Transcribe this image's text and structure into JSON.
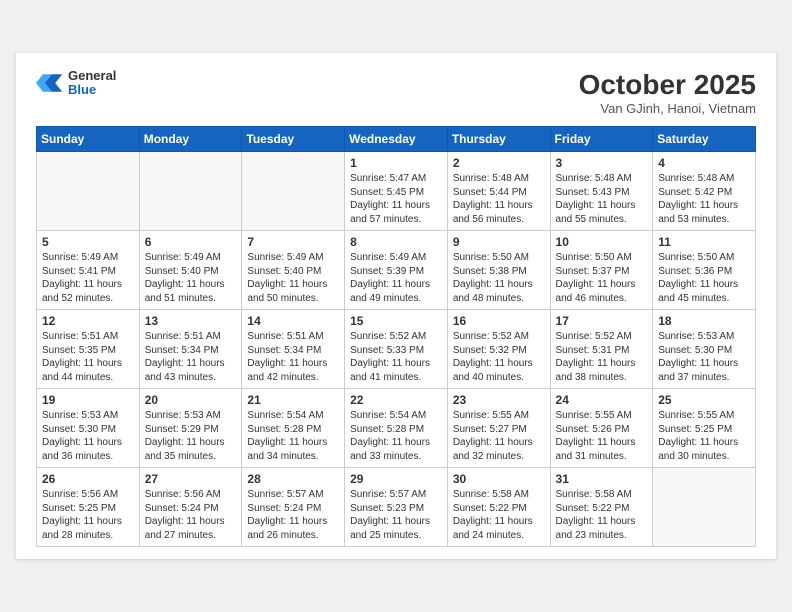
{
  "header": {
    "logo": {
      "general": "General",
      "blue": "Blue"
    },
    "title": "October 2025",
    "location": "Van GJinh, Hanoi, Vietnam"
  },
  "weekdays": [
    "Sunday",
    "Monday",
    "Tuesday",
    "Wednesday",
    "Thursday",
    "Friday",
    "Saturday"
  ],
  "weeks": [
    [
      {
        "day": "",
        "info": ""
      },
      {
        "day": "",
        "info": ""
      },
      {
        "day": "",
        "info": ""
      },
      {
        "day": "1",
        "info": "Sunrise: 5:47 AM\nSunset: 5:45 PM\nDaylight: 11 hours\nand 57 minutes."
      },
      {
        "day": "2",
        "info": "Sunrise: 5:48 AM\nSunset: 5:44 PM\nDaylight: 11 hours\nand 56 minutes."
      },
      {
        "day": "3",
        "info": "Sunrise: 5:48 AM\nSunset: 5:43 PM\nDaylight: 11 hours\nand 55 minutes."
      },
      {
        "day": "4",
        "info": "Sunrise: 5:48 AM\nSunset: 5:42 PM\nDaylight: 11 hours\nand 53 minutes."
      }
    ],
    [
      {
        "day": "5",
        "info": "Sunrise: 5:49 AM\nSunset: 5:41 PM\nDaylight: 11 hours\nand 52 minutes."
      },
      {
        "day": "6",
        "info": "Sunrise: 5:49 AM\nSunset: 5:40 PM\nDaylight: 11 hours\nand 51 minutes."
      },
      {
        "day": "7",
        "info": "Sunrise: 5:49 AM\nSunset: 5:40 PM\nDaylight: 11 hours\nand 50 minutes."
      },
      {
        "day": "8",
        "info": "Sunrise: 5:49 AM\nSunset: 5:39 PM\nDaylight: 11 hours\nand 49 minutes."
      },
      {
        "day": "9",
        "info": "Sunrise: 5:50 AM\nSunset: 5:38 PM\nDaylight: 11 hours\nand 48 minutes."
      },
      {
        "day": "10",
        "info": "Sunrise: 5:50 AM\nSunset: 5:37 PM\nDaylight: 11 hours\nand 46 minutes."
      },
      {
        "day": "11",
        "info": "Sunrise: 5:50 AM\nSunset: 5:36 PM\nDaylight: 11 hours\nand 45 minutes."
      }
    ],
    [
      {
        "day": "12",
        "info": "Sunrise: 5:51 AM\nSunset: 5:35 PM\nDaylight: 11 hours\nand 44 minutes."
      },
      {
        "day": "13",
        "info": "Sunrise: 5:51 AM\nSunset: 5:34 PM\nDaylight: 11 hours\nand 43 minutes."
      },
      {
        "day": "14",
        "info": "Sunrise: 5:51 AM\nSunset: 5:34 PM\nDaylight: 11 hours\nand 42 minutes."
      },
      {
        "day": "15",
        "info": "Sunrise: 5:52 AM\nSunset: 5:33 PM\nDaylight: 11 hours\nand 41 minutes."
      },
      {
        "day": "16",
        "info": "Sunrise: 5:52 AM\nSunset: 5:32 PM\nDaylight: 11 hours\nand 40 minutes."
      },
      {
        "day": "17",
        "info": "Sunrise: 5:52 AM\nSunset: 5:31 PM\nDaylight: 11 hours\nand 38 minutes."
      },
      {
        "day": "18",
        "info": "Sunrise: 5:53 AM\nSunset: 5:30 PM\nDaylight: 11 hours\nand 37 minutes."
      }
    ],
    [
      {
        "day": "19",
        "info": "Sunrise: 5:53 AM\nSunset: 5:30 PM\nDaylight: 11 hours\nand 36 minutes."
      },
      {
        "day": "20",
        "info": "Sunrise: 5:53 AM\nSunset: 5:29 PM\nDaylight: 11 hours\nand 35 minutes."
      },
      {
        "day": "21",
        "info": "Sunrise: 5:54 AM\nSunset: 5:28 PM\nDaylight: 11 hours\nand 34 minutes."
      },
      {
        "day": "22",
        "info": "Sunrise: 5:54 AM\nSunset: 5:28 PM\nDaylight: 11 hours\nand 33 minutes."
      },
      {
        "day": "23",
        "info": "Sunrise: 5:55 AM\nSunset: 5:27 PM\nDaylight: 11 hours\nand 32 minutes."
      },
      {
        "day": "24",
        "info": "Sunrise: 5:55 AM\nSunset: 5:26 PM\nDaylight: 11 hours\nand 31 minutes."
      },
      {
        "day": "25",
        "info": "Sunrise: 5:55 AM\nSunset: 5:25 PM\nDaylight: 11 hours\nand 30 minutes."
      }
    ],
    [
      {
        "day": "26",
        "info": "Sunrise: 5:56 AM\nSunset: 5:25 PM\nDaylight: 11 hours\nand 28 minutes."
      },
      {
        "day": "27",
        "info": "Sunrise: 5:56 AM\nSunset: 5:24 PM\nDaylight: 11 hours\nand 27 minutes."
      },
      {
        "day": "28",
        "info": "Sunrise: 5:57 AM\nSunset: 5:24 PM\nDaylight: 11 hours\nand 26 minutes."
      },
      {
        "day": "29",
        "info": "Sunrise: 5:57 AM\nSunset: 5:23 PM\nDaylight: 11 hours\nand 25 minutes."
      },
      {
        "day": "30",
        "info": "Sunrise: 5:58 AM\nSunset: 5:22 PM\nDaylight: 11 hours\nand 24 minutes."
      },
      {
        "day": "31",
        "info": "Sunrise: 5:58 AM\nSunset: 5:22 PM\nDaylight: 11 hours\nand 23 minutes."
      },
      {
        "day": "",
        "info": ""
      }
    ]
  ]
}
